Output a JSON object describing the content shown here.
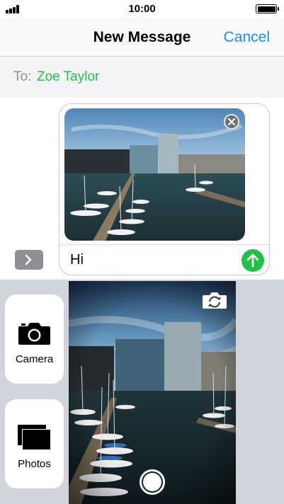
{
  "status_bar": {
    "time": "10:00",
    "signal_icon": "signal-bars-icon",
    "battery_icon": "battery-full-icon"
  },
  "nav": {
    "title": "New Message",
    "cancel_label": "Cancel"
  },
  "recipient": {
    "label": "To:",
    "name": "Zoe Taylor"
  },
  "compose": {
    "expand_icon": "chevron-right-icon",
    "attachment_icon": "photo-harbour-thumbnail",
    "remove_icon": "close-icon",
    "message_text": "Hi",
    "send_icon": "arrow-up-icon"
  },
  "picker": {
    "camera_label": "Camera",
    "camera_icon": "camera-icon",
    "photos_label": "Photos",
    "photos_icon": "photos-stack-icon",
    "flip_icon": "flip-camera-icon",
    "shutter_icon": "shutter-button"
  },
  "colors": {
    "accent_blue": "#1a8cff",
    "imessage_green": "#21c04a",
    "picker_background": "#d1d5db"
  }
}
